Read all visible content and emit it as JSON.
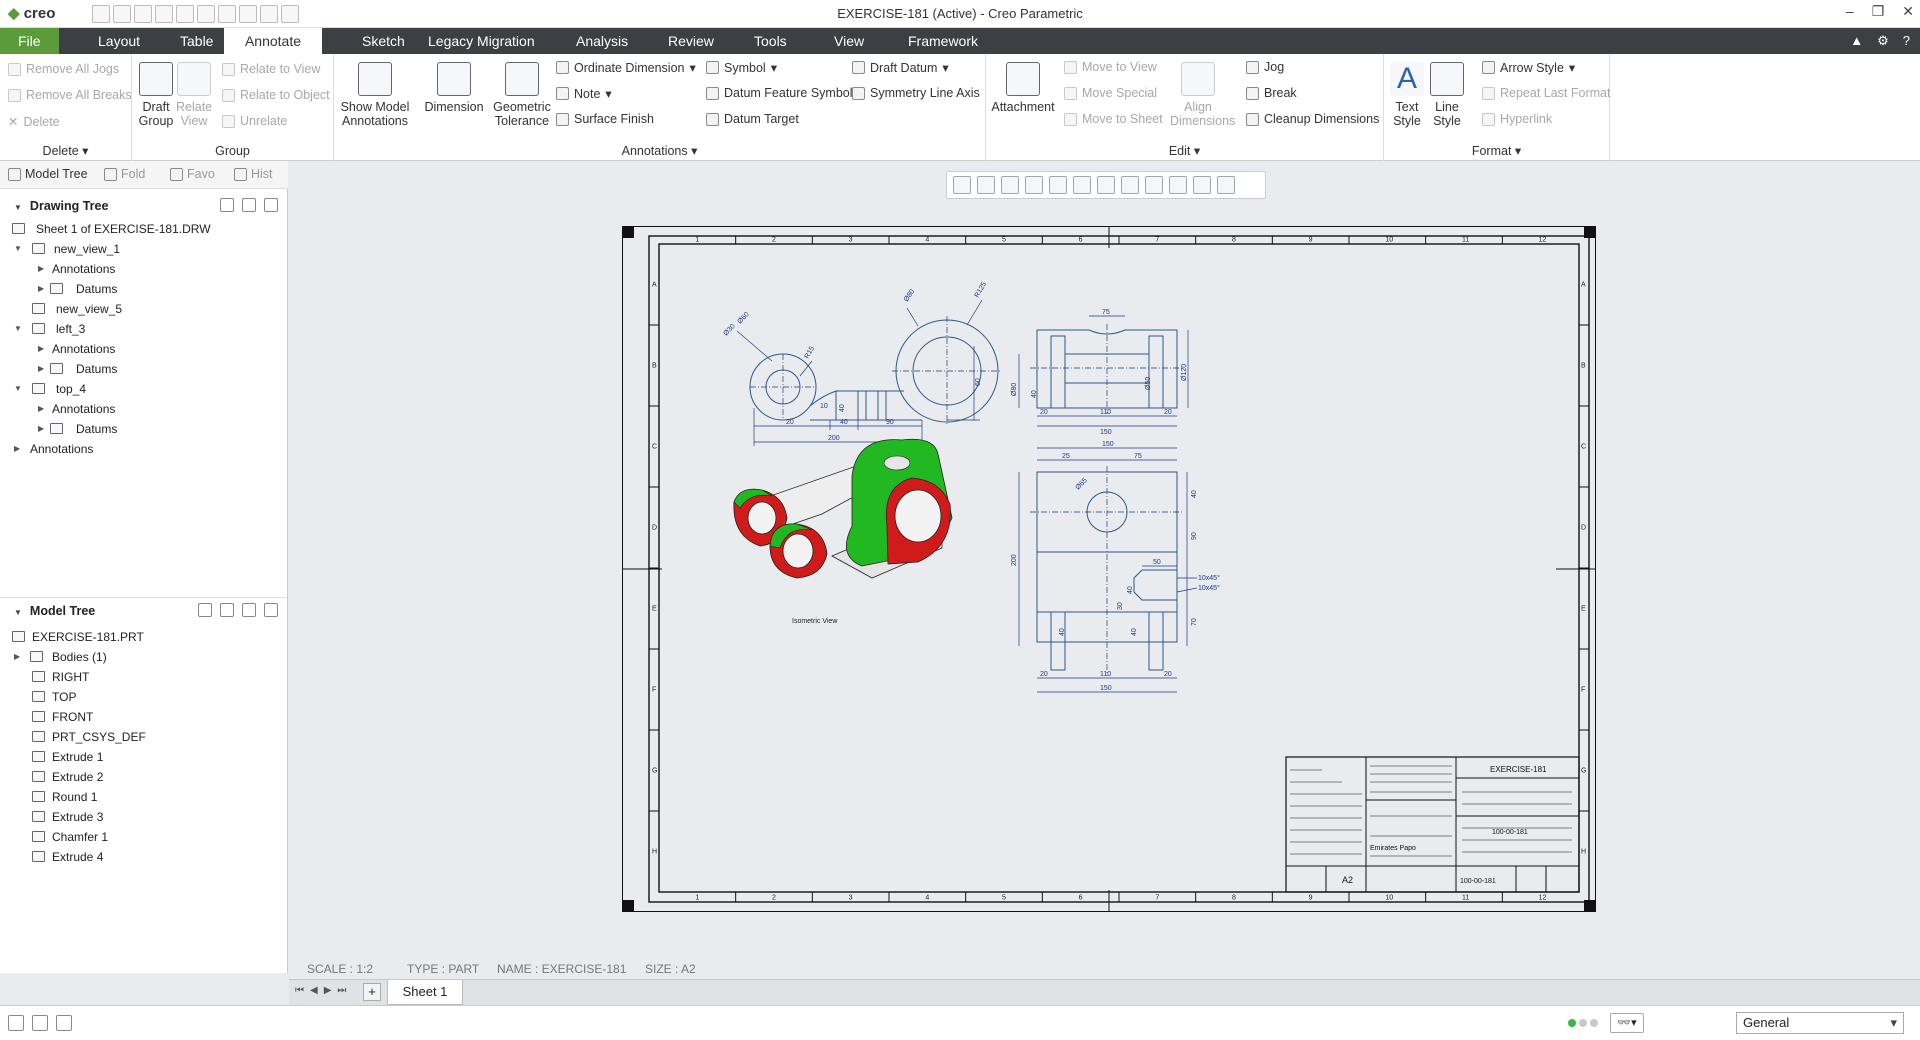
{
  "window": {
    "app_name": "creo",
    "title": "EXERCISE-181 (Active) - Creo Parametric"
  },
  "menu": {
    "file": "File",
    "tabs": [
      "Layout",
      "Table",
      "Annotate",
      "Sketch",
      "Legacy Migration",
      "Analysis",
      "Review",
      "Tools",
      "View",
      "Framework"
    ],
    "active": "Annotate"
  },
  "ribbon": {
    "delete": {
      "items": [
        "Remove All Jogs",
        "Remove All Breaks",
        "Delete"
      ],
      "label": "Delete"
    },
    "group": {
      "draft_group": "Draft Group",
      "relate_view": "Relate View",
      "items": [
        "Relate to View",
        "Relate to Object",
        "Unrelate"
      ],
      "label": "Group"
    },
    "annotations": {
      "show_model": "Show Model Annotations",
      "dimension": "Dimension",
      "geom_tol": "Geometric Tolerance",
      "col1": [
        "Ordinate Dimension",
        "Note",
        "Surface Finish"
      ],
      "col2": [
        "Symbol",
        "Datum Feature Symbol",
        "Datum Target"
      ],
      "col3": [
        "Draft Datum",
        "Symmetry Line Axis"
      ],
      "label": "Annotations"
    },
    "edit": {
      "attachment": "Attachment",
      "moves": [
        "Move to View",
        "Move Special",
        "Move to Sheet"
      ],
      "align": "Align Dimensions",
      "col": [
        "Jog",
        "Break",
        "Cleanup Dimensions"
      ],
      "label": "Edit"
    },
    "format": {
      "text_style": "Text Style",
      "line_style": "Line Style",
      "col": [
        "Arrow Style",
        "Repeat Last Format",
        "Hyperlink"
      ],
      "label": "Format"
    }
  },
  "left_panel": {
    "tabs": [
      "Model Tree",
      "Fold",
      "Favo",
      "Hist"
    ],
    "drawing_tree": {
      "title": "Drawing Tree",
      "items": [
        "Sheet 1 of EXERCISE-181.DRW",
        "new_view_1",
        "Annotations",
        "Datums",
        "new_view_5",
        "left_3",
        "Annotations",
        "Datums",
        "top_4",
        "Annotations",
        "Datums",
        "Annotations"
      ]
    },
    "model_tree": {
      "title": "Model Tree",
      "items": [
        "EXERCISE-181.PRT",
        "Bodies (1)",
        "RIGHT",
        "TOP",
        "FRONT",
        "PRT_CSYS_DEF",
        "Extrude 1",
        "Extrude 2",
        "Round 1",
        "Extrude 3",
        "Chamfer 1",
        "Extrude 4"
      ]
    }
  },
  "drawing": {
    "dims_front": [
      "Ø60",
      "Ø30",
      "R15",
      "Ø80",
      "R125",
      "10",
      "40",
      "20",
      "40",
      "90",
      "200",
      "60"
    ],
    "dims_side": [
      "75",
      "Ø80",
      "40",
      "Ø50",
      "Ø120",
      "20",
      "110",
      "20",
      "150"
    ],
    "dims_top": [
      "150",
      "25",
      "75",
      "Ø65",
      "40",
      "90",
      "50",
      "10x45°",
      "10x45°",
      "40",
      "30",
      "70",
      "200",
      "40",
      "40",
      "20",
      "110",
      "20",
      "150"
    ],
    "iso_label": "Isometric View",
    "border_cols": [
      "1",
      "2",
      "3",
      "4",
      "5",
      "6",
      "7",
      "8",
      "9",
      "10",
      "11",
      "12"
    ],
    "border_rows": [
      "A",
      "B",
      "C",
      "D",
      "E",
      "F",
      "G",
      "H"
    ],
    "title_block": {
      "name": "EXERCISE-181",
      "size": "A2",
      "number": "100-00-181",
      "drawn": "Emirates Papo"
    }
  },
  "info_bar": {
    "scale": "SCALE : 1:2",
    "type": "TYPE : PART",
    "name": "NAME : EXERCISE-181",
    "size": "SIZE : A2"
  },
  "sheet_tab": "Sheet 1",
  "status": {
    "filter": "General"
  },
  "colors": {
    "menubar": "#3c3f43",
    "file_tab": "#5c9b3a",
    "model_green": "#1fb81f",
    "model_red": "#d11a1a",
    "dim_blue": "#1e3a8a",
    "geom_blue": "#2b5a8a"
  }
}
